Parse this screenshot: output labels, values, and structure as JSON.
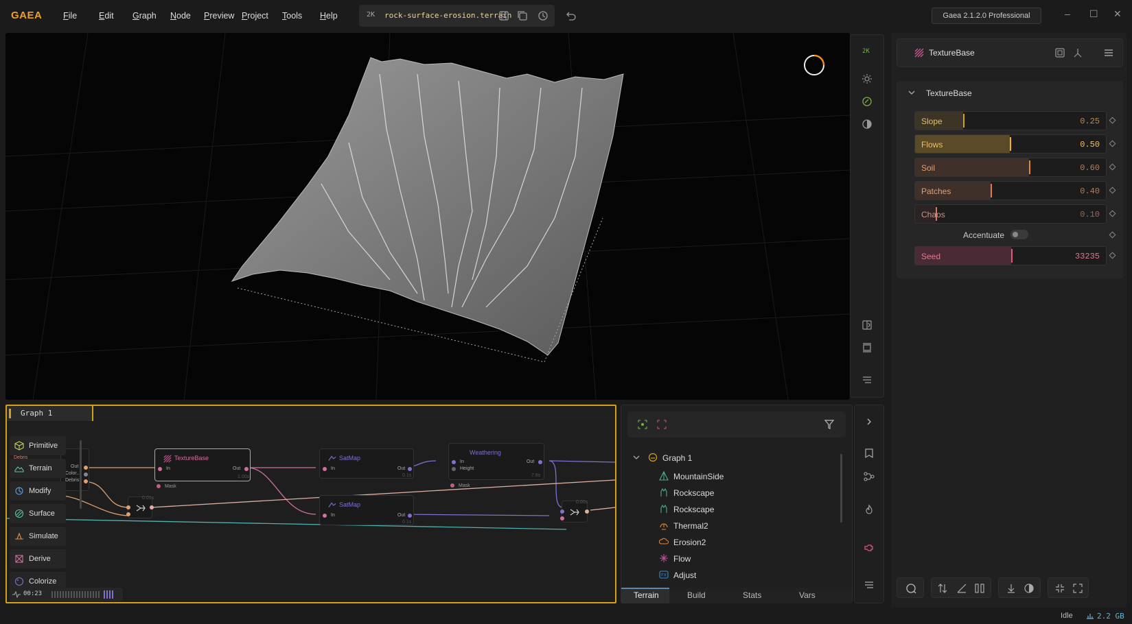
{
  "app": {
    "logo": "GAEA"
  },
  "menu": [
    "File",
    "Edit",
    "Graph",
    "Node",
    "Preview",
    "Project",
    "Tools",
    "Help"
  ],
  "file": {
    "resolution": "2K",
    "name": "rock-surface-erosion.terrain"
  },
  "version": "Gaea 2.1.2.0 Professional",
  "viewport_toolbar": {
    "resolution": "2K"
  },
  "properties": {
    "node_title": "TextureBase",
    "section_title": "TextureBase",
    "sliders": [
      {
        "label": "Slope",
        "value": "0.25",
        "fraction": 0.25
      },
      {
        "label": "Flows",
        "value": "0.50",
        "fraction": 0.5
      },
      {
        "label": "Soil",
        "value": "0.60",
        "fraction": 0.6
      },
      {
        "label": "Patches",
        "value": "0.40",
        "fraction": 0.4
      },
      {
        "label": "Chaos",
        "value": "0.10",
        "fraction": 0.1
      }
    ],
    "accentuate_label": "Accentuate",
    "accentuate_on": false,
    "seed": {
      "label": "Seed",
      "value": "33235",
      "fraction": 0.5
    }
  },
  "graph": {
    "tab": "Graph 1",
    "palette": [
      "Primitive",
      "Terrain",
      "Modify",
      "Surface",
      "Simulate",
      "Derive",
      "Colorize"
    ],
    "nodes": {
      "texturebase": {
        "title": "TextureBase",
        "in": "In",
        "out": "Out",
        "mask": "Mask",
        "time": "1.00s"
      },
      "satmap1": {
        "title": "SatMap",
        "in": "In",
        "out": "Out",
        "time": "0.1s"
      },
      "satmap2": {
        "title": "SatMap",
        "in": "In",
        "out": "Out",
        "time": "0.1s"
      },
      "weathering": {
        "title": "Weathering",
        "in": "In",
        "height": "Height",
        "out": "Out",
        "mask": "Mask",
        "time": "7.8s"
      },
      "left_node": {
        "out": "Out",
        "color": "Color...",
        "debris": "Debris",
        "label": "Debris"
      },
      "combine1": {
        "time": "0.01s"
      },
      "combine2": {
        "time": "0.00s"
      }
    },
    "timer": "00:23"
  },
  "outline": {
    "root": "Graph 1",
    "items": [
      {
        "label": "MountainSide",
        "icon": "mountain-icon",
        "color": "#4fb08a"
      },
      {
        "label": "Rockscape",
        "icon": "rock-icon",
        "color": "#4fb08a"
      },
      {
        "label": "Rockscape",
        "icon": "rock-icon",
        "color": "#4fb08a"
      },
      {
        "label": "Thermal2",
        "icon": "thermal-icon",
        "color": "#e0883a"
      },
      {
        "label": "Erosion2",
        "icon": "erosion-icon",
        "color": "#e0883a"
      },
      {
        "label": "Flow",
        "icon": "flow-icon",
        "color": "#c0509a"
      },
      {
        "label": "Adjust",
        "icon": "adjust-icon",
        "color": "#3a8acc"
      }
    ],
    "tabs": [
      "Terrain",
      "Build",
      "Stats",
      "Vars"
    ]
  },
  "status": {
    "state": "Idle",
    "memory": "2.2 GB"
  },
  "colors": {
    "accent": "#d6a11a",
    "brand": "#f0a020"
  }
}
